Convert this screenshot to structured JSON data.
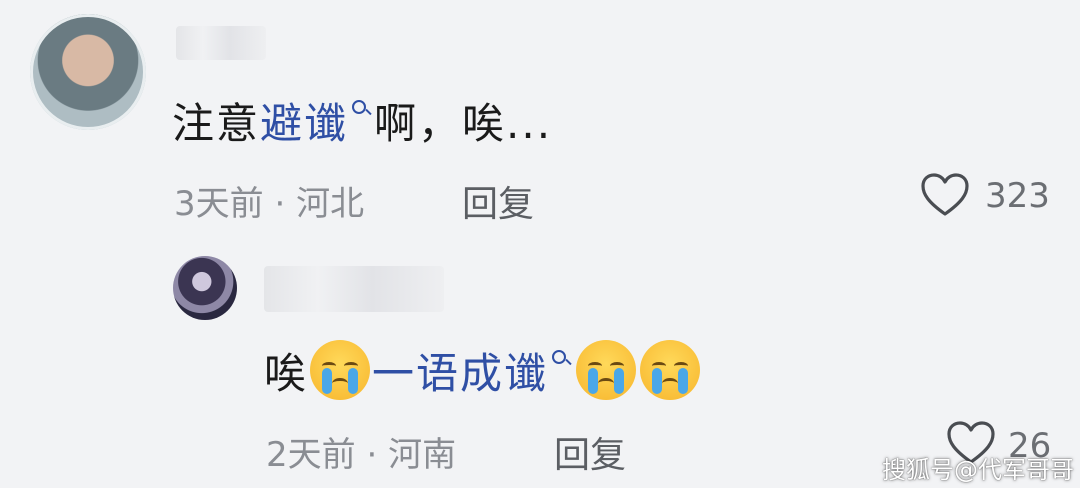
{
  "comments": [
    {
      "text_before": "注意",
      "link_text": "避谶",
      "text_after": "啊，唉...",
      "time": "3天前",
      "location": "河北",
      "reply_label": "回复",
      "likes": "323"
    },
    {
      "text_before": "唉",
      "text_middle": "一语成谶",
      "time": "2天前",
      "location": "河南",
      "reply_label": "回复",
      "likes": "26"
    }
  ],
  "watermark": "搜狐号@代军哥哥",
  "icons": [
    "avatar",
    "search-icon",
    "crying-emoji",
    "heart-icon"
  ]
}
